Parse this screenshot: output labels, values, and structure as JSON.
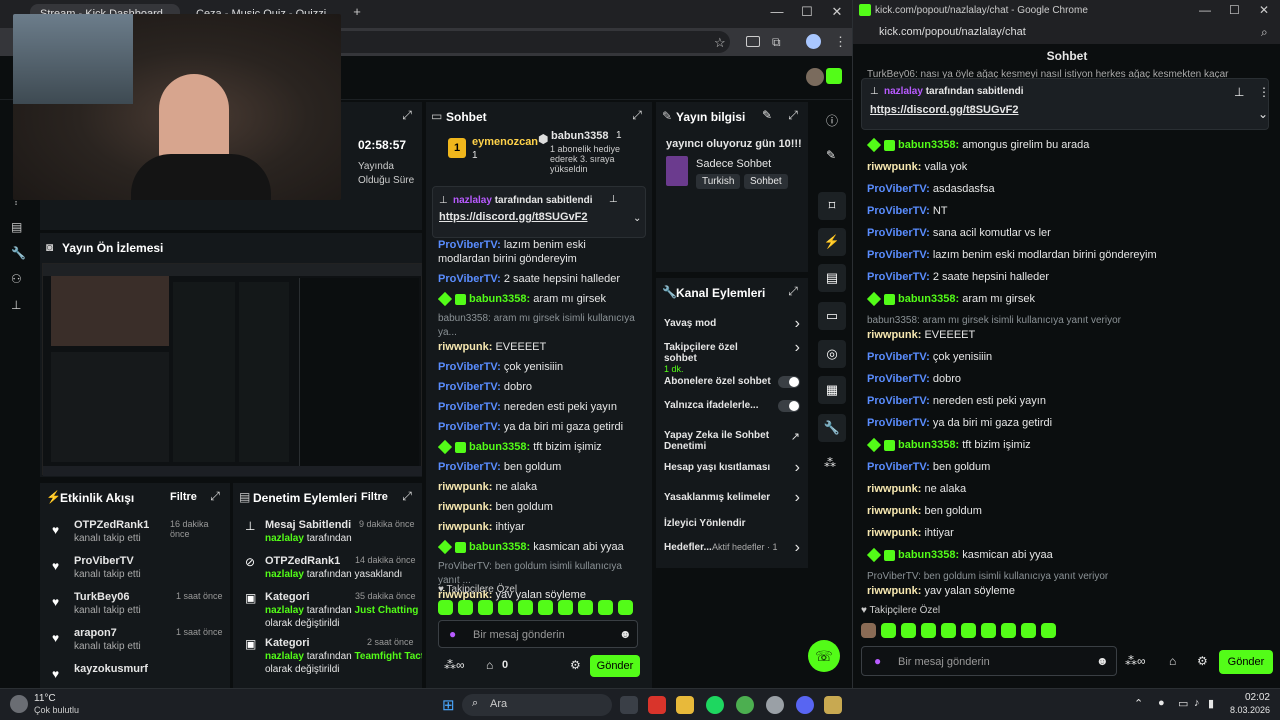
{
  "left_browser": {
    "tabs": [
      {
        "label": "Stream - Kick Dashboard"
      },
      {
        "label": "Ceza - Music Quiz - Quizzi"
      }
    ],
    "controls": {
      "minimize": "—",
      "maximize": "☐",
      "close": "✕",
      "new_tab": "+"
    }
  },
  "stream_manager": {
    "timer": "02:58:57",
    "timer_label": "Yayında Olduğu Süre",
    "preview_title": "Yayın Ön İzlemesi",
    "chat": {
      "title": "Sohbet",
      "gifter": {
        "name": "eymenozcan",
        "count": "1"
      },
      "top_user": {
        "name": "babun3358",
        "count": "1",
        "note": "1 abonelik hediye ederek 3. sıraya yükseldin"
      },
      "pinned": {
        "by": "nazlalay",
        "suffix": "tarafından sabitlendi",
        "link": "https://discord.gg/t8SUGvF2"
      },
      "messages": [
        {
          "user": "ProViberTV",
          "text": "lazım benim eski modlardan birini göndereyim",
          "kind": "pv"
        },
        {
          "user": "ProViberTV",
          "text": "2 saate hepsini halleder",
          "kind": "pv"
        },
        {
          "user": "babun3358",
          "text": "aram mı girsek",
          "kind": "bb"
        },
        {
          "reply": "babun3358: aram mı girsek isimli kullanıcıya ya...",
          "user": "riwwpunk",
          "text": "EVEEEET",
          "kind": "rw"
        },
        {
          "user": "ProViberTV",
          "text": "çok yenisiiin",
          "kind": "pv"
        },
        {
          "user": "ProViberTV",
          "text": "dobro",
          "kind": "pv"
        },
        {
          "user": "ProViberTV",
          "text": "nereden esti peki yayın",
          "kind": "pv"
        },
        {
          "user": "ProViberTV",
          "text": "ya da biri mi gaza getirdi",
          "kind": "pv"
        },
        {
          "user": "babun3358",
          "text": "tft bizim işimiz",
          "kind": "bb"
        },
        {
          "user": "ProViberTV",
          "text": "ben goldum",
          "kind": "pv"
        },
        {
          "user": "riwwpunk",
          "text": "ne alaka",
          "kind": "rw"
        },
        {
          "user": "riwwpunk",
          "text": "ben goldum",
          "kind": "rw"
        },
        {
          "user": "riwwpunk",
          "text": "ihtiyar",
          "kind": "rw"
        },
        {
          "user": "babun3358",
          "text": "kasmican abi yyaa",
          "kind": "bb"
        },
        {
          "reply": "ProViberTV: ben goldum isimli kullanıcıya yanıt ...",
          "user": "riwwpunk",
          "text": "yav yalan söyleme",
          "kind": "rw"
        }
      ],
      "followers_only": "Takipçilere Özel",
      "input_placeholder": "Bir mesaj gönderin",
      "count": "0",
      "send": "Gönder"
    },
    "stream_info": {
      "title": "Yayın bilgisi",
      "stream_title": "yayıncı oluyoruz gün 10!!!",
      "category": "Sadece Sohbet",
      "tags": [
        "Turkish",
        "Sohbet"
      ]
    },
    "channel_actions": {
      "title": "Kanal Eylemleri",
      "items": [
        {
          "label": "Yavaş mod",
          "type": "arrow"
        },
        {
          "label": "Takipçilere özel sohbet",
          "sub": "1 dk.",
          "type": "arrow"
        },
        {
          "label": "Abonelere özel sohbet",
          "type": "toggle"
        },
        {
          "label": "Yalnızca ifadelerle...",
          "type": "toggle"
        },
        {
          "label": "Yapay Zeka ile Sohbet Denetimi",
          "type": "ext"
        },
        {
          "label": "Hesap yaşı kısıtlaması",
          "type": "arrow"
        },
        {
          "label": "Yasaklanmış kelimeler",
          "type": "arrow"
        },
        {
          "label": "İzleyici Yönlendir",
          "type": "none"
        },
        {
          "label": "Hedefler...",
          "sub": "Aktif hedefler · 1",
          "type": "arrow"
        }
      ]
    },
    "activity": {
      "title": "Etkinlik Akışı",
      "filter": "Filtre",
      "items": [
        {
          "name": "OTPZedRank1",
          "desc": "kanalı takip etti",
          "time": "16 dakika önce"
        },
        {
          "name": "ProViberTV",
          "desc": "kanalı takip etti",
          "time": ""
        },
        {
          "name": "TurkBey06",
          "desc": "kanalı takip etti",
          "time": "1 saat önce"
        },
        {
          "name": "arapon7",
          "desc": "kanalı takip etti",
          "time": "1 saat önce"
        },
        {
          "name": "kayzokusmurf",
          "desc": "",
          "time": ""
        }
      ]
    },
    "moderation": {
      "title": "Denetim Eylemleri",
      "filter": "Filtre",
      "items": [
        {
          "title": "Mesaj Sabitlendi",
          "actor": "nazlalay",
          "desc": "tarafından",
          "extra": "",
          "time": "9 dakika önce"
        },
        {
          "title": "OTPZedRank1",
          "actor": "nazlalay",
          "desc": "tarafından yasaklandı",
          "extra": "",
          "time": "14 dakika önce"
        },
        {
          "title": "Kategori",
          "actor": "nazlalay",
          "desc": "tarafından",
          "extra": "Just Chatting",
          "line2": "olarak değiştirildi",
          "time": "35 dakika önce"
        },
        {
          "title": "Kategori",
          "actor": "nazlalay",
          "desc": "tarafından",
          "extra": "Teamfight Tactics",
          "line2": "olarak değiştirildi",
          "time": "2 saat önce"
        }
      ]
    }
  },
  "popout": {
    "window_title": "kick.com/popout/nazlalay/chat - Google Chrome",
    "url": "kick.com/popout/nazlalay/chat",
    "header": "Sohbet",
    "cut_line": "TurkBey06: nası ya öyle ağaç kesmeyi nasıl istiyon herkes ağaç kesmekten kaçar",
    "pinned": {
      "by": "nazlalay",
      "suffix": "tarafından sabitlendi",
      "link": "https://discord.gg/t8SUGvF2"
    },
    "messages": [
      {
        "user": "babun3358",
        "text": "amongus girelim bu arada",
        "kind": "bb"
      },
      {
        "user": "riwwpunk",
        "text": "valla yok",
        "kind": "rw"
      },
      {
        "user": "ProViberTV",
        "text": "asdasdasfsa",
        "kind": "pv"
      },
      {
        "user": "ProViberTV",
        "text": "NT",
        "kind": "pv"
      },
      {
        "user": "ProViberTV",
        "text": "sana acil komutlar vs ler",
        "kind": "pv"
      },
      {
        "user": "ProViberTV",
        "text": "lazım benim eski modlardan birini göndereyim",
        "kind": "pv"
      },
      {
        "user": "ProViberTV",
        "text": "2 saate hepsini halleder",
        "kind": "pv"
      },
      {
        "user": "babun3358",
        "text": "aram mı girsek",
        "kind": "bb"
      },
      {
        "reply": "babun3358: aram mı girsek isimli kullanıcıya yanıt veriyor",
        "user": "riwwpunk",
        "text": "EVEEEET",
        "kind": "rw"
      },
      {
        "user": "ProViberTV",
        "text": "çok yenisiiin",
        "kind": "pv"
      },
      {
        "user": "ProViberTV",
        "text": "dobro",
        "kind": "pv"
      },
      {
        "user": "ProViberTV",
        "text": "nereden esti peki yayın",
        "kind": "pv"
      },
      {
        "user": "ProViberTV",
        "text": "ya da biri mi gaza getirdi",
        "kind": "pv"
      },
      {
        "user": "babun3358",
        "text": "tft bizim işimiz",
        "kind": "bb"
      },
      {
        "user": "ProViberTV",
        "text": "ben goldum",
        "kind": "pv"
      },
      {
        "user": "riwwpunk",
        "text": "ne alaka",
        "kind": "rw"
      },
      {
        "user": "riwwpunk",
        "text": "ben goldum",
        "kind": "rw"
      },
      {
        "user": "riwwpunk",
        "text": "ihtiyar",
        "kind": "rw"
      },
      {
        "user": "babun3358",
        "text": "kasmican abi yyaa",
        "kind": "bb"
      },
      {
        "reply": "ProViberTV: ben goldum isimli kullanıcıya yanıt veriyor",
        "user": "riwwpunk",
        "text": "yav yalan söyleme",
        "kind": "rw"
      }
    ],
    "followers_only": "Takipçilere Özel",
    "input_placeholder": "Bir mesaj gönderin",
    "send": "Gönder"
  },
  "taskbar": {
    "weather_temp": "11°C",
    "weather_desc": "Çok bulutlu",
    "search": "Ara",
    "time": "02:02",
    "date": "8.03.2026"
  },
  "colors": {
    "accent": "#53fc18",
    "panel": "#14181b",
    "bg": "#0b0e0f",
    "user_pv": "#5a8dff",
    "user_rw": "#f6e7b0"
  }
}
